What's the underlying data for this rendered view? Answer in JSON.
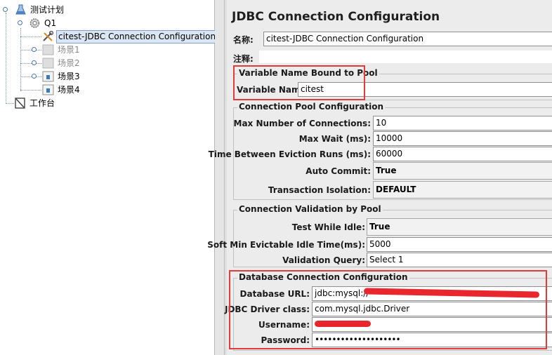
{
  "tree": {
    "root": "测试计划",
    "thread_group": "Q1",
    "selected": "citest-JDBC Connection Configuration",
    "scenes": [
      "场景1",
      "场景2",
      "场景3",
      "场景4"
    ],
    "workbench": "工作台"
  },
  "panel": {
    "title": "JDBC Connection Configuration",
    "name_label": "名称:",
    "name_value": "citest-JDBC Connection Configuration",
    "comment_label": "注释:"
  },
  "variable_group": {
    "legend": "Variable Name Bound to Pool",
    "variable_name_label": "Variable Name:",
    "variable_name_value": "citest"
  },
  "pool_group": {
    "legend": "Connection Pool Configuration",
    "max_connections_label": "Max Number of Connections:",
    "max_connections_value": "10",
    "max_wait_label": "Max Wait (ms):",
    "max_wait_value": "10000",
    "eviction_label": "Time Between Eviction Runs (ms):",
    "eviction_value": "60000",
    "auto_commit_label": "Auto Commit:",
    "auto_commit_value": "True",
    "isolation_label": "Transaction Isolation:",
    "isolation_value": "DEFAULT"
  },
  "validation_group": {
    "legend": "Connection Validation by Pool",
    "test_idle_label": "Test While Idle:",
    "test_idle_value": "True",
    "soft_min_label": "Soft Min Evictable Idle Time(ms):",
    "soft_min_value": "5000",
    "query_label": "Validation Query:",
    "query_value": "Select 1"
  },
  "db_group": {
    "legend": "Database Connection Configuration",
    "url_label": "Database URL:",
    "url_value": "jdbc:mysql://",
    "driver_label": "JDBC Driver class:",
    "driver_value": "com.mysql.jdbc.Driver",
    "username_label": "Username:",
    "username_value": "",
    "password_label": "Password:",
    "password_value": "••••••••••••••••••••"
  },
  "colors": {
    "highlight": "#e03c3c",
    "selection": "#dbe6f4",
    "panel_bg": "#ececec"
  }
}
